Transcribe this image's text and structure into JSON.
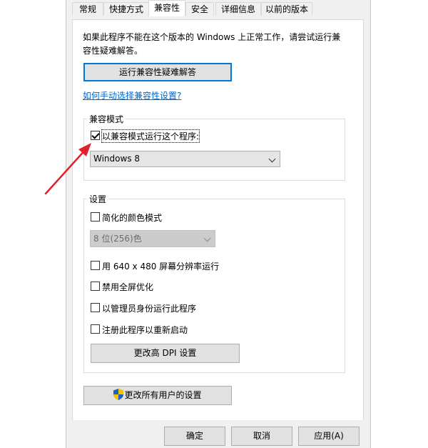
{
  "tabs": [
    "常规",
    "快捷方式",
    "兼容性",
    "安全",
    "详细信息",
    "以前的版本"
  ],
  "active_tab": "兼容性",
  "intro_text": "如果此程序不能在这个版本的 Windows 上正常工作，请尝试运行兼容性疑难解答。",
  "troubleshooter_button": "运行兼容性疑难解答",
  "manual_link": "如何手动选择兼容性设置?",
  "compat_mode": {
    "legend": "兼容模式",
    "checkbox_label": "以兼容模式运行这个程序:",
    "checked": true,
    "selected_os": "Windows 8"
  },
  "settings": {
    "legend": "设置",
    "reduced_color_label": "简化的颜色模式",
    "color_select_value": "8 位(256)色",
    "resolution_label": "用 640 x 480 屏幕分辨率运行",
    "fullscreen_label": "禁用全屏优化",
    "admin_label": "以管理员身份运行此程序",
    "restart_label": "注册此程序以重新启动",
    "dpi_button": "更改高 DPI 设置"
  },
  "all_users_button": "更改所有用户的设置",
  "footer": {
    "ok": "确定",
    "cancel": "取消",
    "apply": "应用(A)"
  },
  "colors": {
    "accent": "#0078d7",
    "link": "#0066cc",
    "annotation_arrow": "#e0202a"
  },
  "icons": {
    "shield": "uac-shield-icon"
  }
}
